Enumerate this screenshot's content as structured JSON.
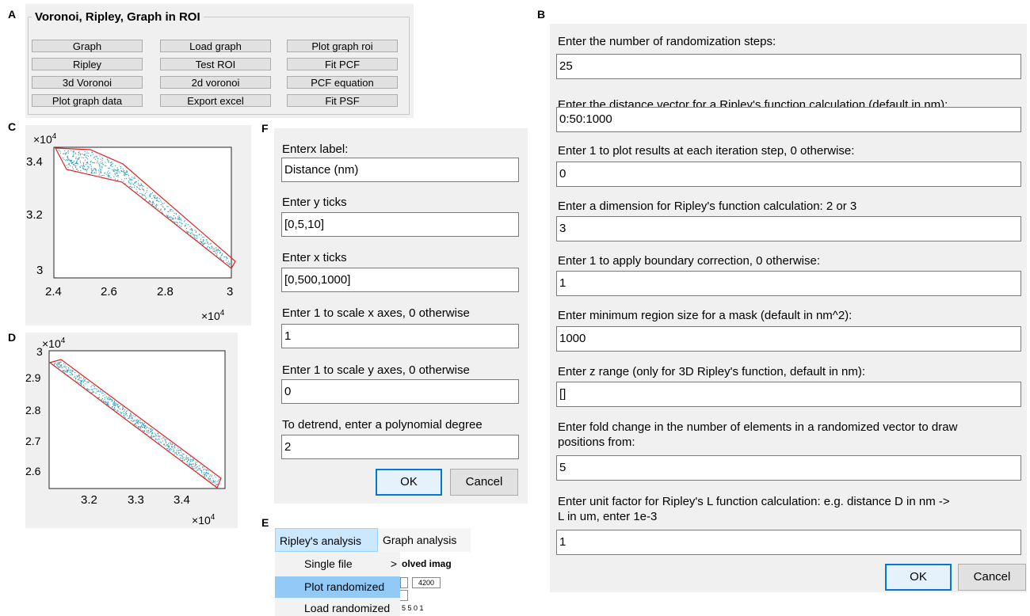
{
  "panel_labels": {
    "a": "A",
    "b": "B",
    "c": "C",
    "d": "D",
    "e": "E",
    "f": "F"
  },
  "panelA": {
    "title": "Voronoi, Ripley, Graph in ROI",
    "buttons": [
      "Graph",
      "Load graph",
      "Plot graph roi",
      "Ripley",
      "Test ROI",
      "Fit PCF",
      "3d Voronoi",
      "2d voronoi",
      "PCF equation",
      "Plot graph data",
      "Export excel",
      "Fit PSF"
    ]
  },
  "panelB": {
    "fields": [
      {
        "label": "Enter the number of randomization steps:",
        "value": "25"
      },
      {
        "label": "Enter the distance vector for a Ripley's function calculation (default in nm):",
        "value": "0:50:1000"
      },
      {
        "label": "Enter 1 to plot results at each iteration step, 0 otherwise:",
        "value": "0"
      },
      {
        "label": "Enter a dimension for Ripley's function calculation: 2 or 3",
        "value": "3"
      },
      {
        "label": "Enter 1 to apply boundary correction, 0 otherwise:",
        "value": "1"
      },
      {
        "label": "Enter minimum region size for a mask (default in nm^2):",
        "value": "1000"
      },
      {
        "label": "Enter z range (only for 3D Ripley's function, default in nm):",
        "value": "[]"
      },
      {
        "label": "Enter fold change in the number of elements in a randomized vector to draw positions from:",
        "label_line1": "Enter fold change in the number of elements in a randomized vector to draw",
        "label_line2": "positions from:",
        "value": "5"
      },
      {
        "label": "Enter unit factor for Ripley's L function calculation: e.g. distance D in nm -> L in um, enter 1e-3",
        "label_line1": "Enter unit factor for Ripley's L function calculation: e.g. distance D in nm ->",
        "label_line2": "L in um, enter 1e-3",
        "value": "1"
      }
    ],
    "ok": "OK",
    "cancel": "Cancel"
  },
  "panelF": {
    "fields": [
      {
        "label": "Enterx label:",
        "value": "Distance (nm)"
      },
      {
        "label": "Enter y ticks",
        "value": "[0,5,10]"
      },
      {
        "label": "Enter x ticks",
        "value": "[0,500,1000]"
      },
      {
        "label": "Enter 1 to scale x axes, 0 otherwise",
        "value": "1"
      },
      {
        "label": "Enter 1 to scale y axes, 0 otherwise",
        "value": "0"
      },
      {
        "label": "To detrend, enter a polynomial degree",
        "value": "2"
      }
    ],
    "ok": "OK",
    "cancel": "Cancel"
  },
  "panelE": {
    "menubar": [
      "Ripley's analysis",
      "Graph analysis"
    ],
    "items": [
      "Single file",
      "Plot randomized",
      "Load randomized"
    ],
    "submenu_arrow": ">",
    "selected_index": 1,
    "background_text": "olved imag",
    "background_values": [
      "4200",
      "5 5 0 1"
    ]
  },
  "plotC": {
    "exp_top": "×10",
    "exp_top_sup": "4",
    "exp_bottom": "×10",
    "exp_bottom_sup": "4",
    "xticks": [
      "2.4",
      "2.6",
      "2.8",
      "3"
    ],
    "yticks": [
      "3.4",
      "3.2",
      "3"
    ],
    "point_color": "#2a9ab8",
    "roi_color": "#e02020"
  },
  "plotD": {
    "exp_top": "×10",
    "exp_top_sup": "4",
    "exp_bottom": "×10",
    "exp_bottom_sup": "4",
    "xticks": [
      "3.2",
      "3.3",
      "3.4"
    ],
    "yticks": [
      "3",
      "2.9",
      "2.8",
      "2.7",
      "2.6"
    ],
    "point_color": "#2a9ab8",
    "roi_color": "#e02020"
  }
}
